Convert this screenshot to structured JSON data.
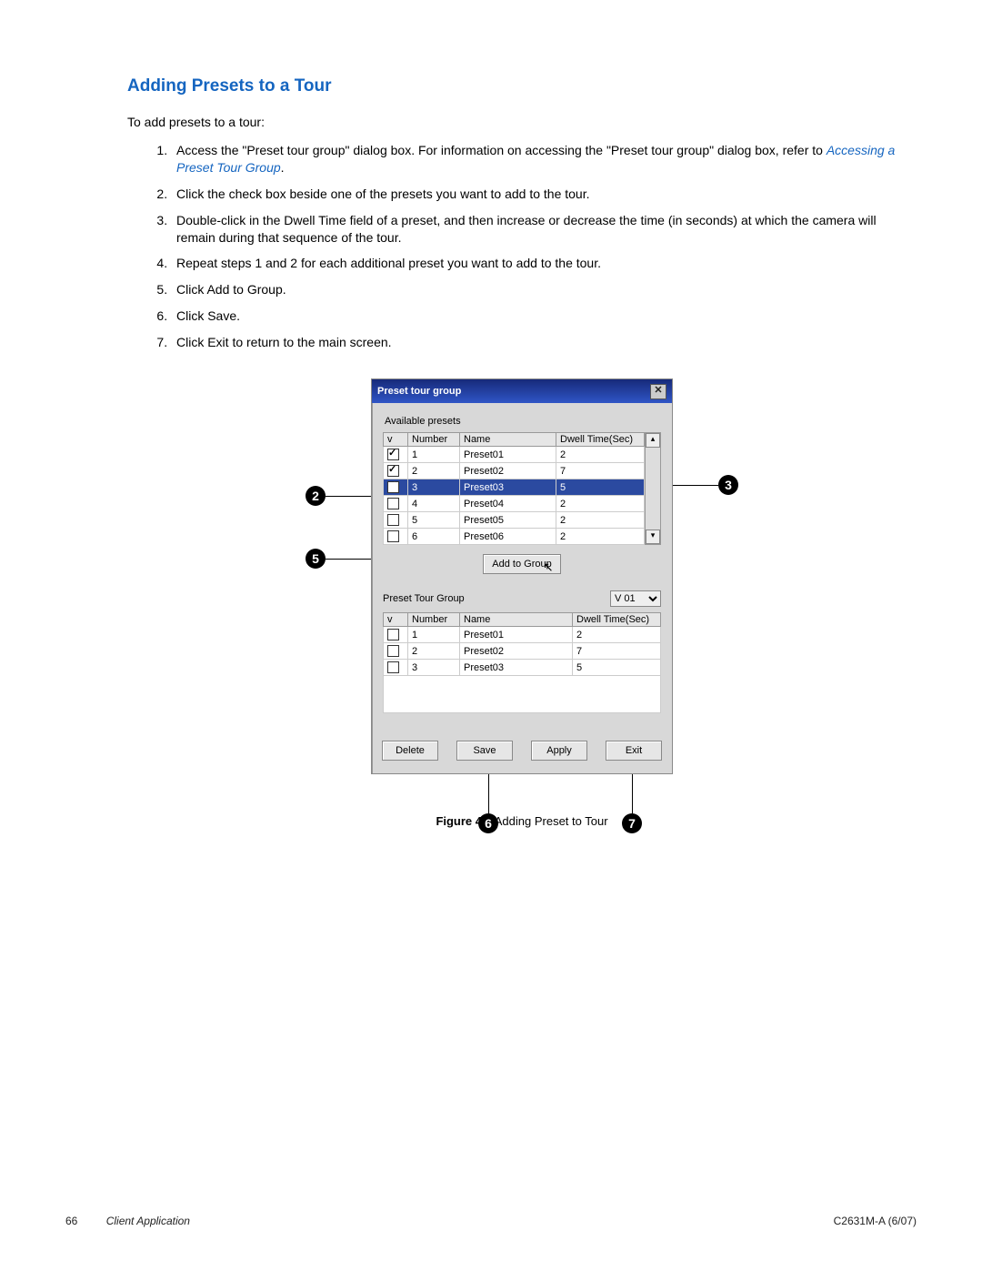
{
  "heading": "Adding Presets to a Tour",
  "intro": "To add presets to a tour:",
  "steps": {
    "s1a": "Access the \"Preset tour group\" dialog box. For information on accessing the \"Preset tour group\" dialog box, refer to ",
    "s1link": "Accessing a Preset Tour Group",
    "s1b": ".",
    "s2": "Click the check box beside one of the presets you want to add to the tour.",
    "s3": "Double-click in the Dwell Time field of a preset, and then increase or decrease the time (in seconds) at which the camera will remain during that sequence of the tour.",
    "s4": "Repeat steps 1 and 2 for each additional preset you want to add to the tour.",
    "s5": "Click Add to Group.",
    "s6": "Click Save.",
    "s7": "Click Exit to return to the main screen."
  },
  "dialog": {
    "title": "Preset tour group",
    "available_label": "Available presets",
    "cols": {
      "v": "v",
      "num": "Number",
      "name": "Name",
      "dwell": "Dwell Time(Sec)"
    },
    "available_rows": [
      {
        "checked": true,
        "num": "1",
        "name": "Preset01",
        "dwell": "2",
        "sel": false
      },
      {
        "checked": true,
        "num": "2",
        "name": "Preset02",
        "dwell": "7",
        "sel": false
      },
      {
        "checked": true,
        "num": "3",
        "name": "Preset03",
        "dwell": "5",
        "sel": true
      },
      {
        "checked": false,
        "num": "4",
        "name": "Preset04",
        "dwell": "2",
        "sel": false
      },
      {
        "checked": false,
        "num": "5",
        "name": "Preset05",
        "dwell": "2",
        "sel": false
      },
      {
        "checked": false,
        "num": "6",
        "name": "Preset06",
        "dwell": "2",
        "sel": false
      }
    ],
    "add_btn": "Add to Group",
    "group_label": "Preset Tour Group",
    "group_value": "V 01",
    "group_rows": [
      {
        "checked": false,
        "num": "1",
        "name": "Preset01",
        "dwell": "2"
      },
      {
        "checked": false,
        "num": "2",
        "name": "Preset02",
        "dwell": "7"
      },
      {
        "checked": false,
        "num": "3",
        "name": "Preset03",
        "dwell": "5"
      }
    ],
    "buttons": {
      "delete": "Delete",
      "save": "Save",
      "apply": "Apply",
      "exit": "Exit"
    }
  },
  "callouts": {
    "c2": "2",
    "c3": "3",
    "c5": "5",
    "c6": "6",
    "c7": "7"
  },
  "caption": {
    "fig": "Figure 47.",
    "text": "  Adding Preset to Tour"
  },
  "footer": {
    "page": "66",
    "app": "Client Application",
    "doc": "C2631M-A (6/07)"
  }
}
